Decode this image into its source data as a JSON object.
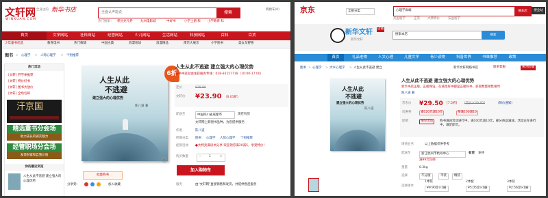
{
  "left": {
    "logo": {
      "text": "文轩网",
      "tagline": "全身边的",
      "sub": "WINXUAN.COM",
      "brand_text": "新华书店"
    },
    "search": {
      "placeholder": "全面认声能说",
      "button": "搜索"
    },
    "hot_links": [
      "热门搜索：",
      "积分兑礼券",
      "九州电影城",
      "中好书",
      "小学上册 科",
      "小学教育 科"
    ],
    "top_right": "购物车(0)",
    "nav": [
      "首页",
      "文学网站",
      "社科网站",
      "经管网站",
      "少儿网站",
      "生活网站",
      "科技网站",
      "百科",
      "百货"
    ],
    "subnav": [
      "少年童书优选",
      "教育电书",
      "热门教辅",
      "中国古典",
      "浪漫地球",
      "浪漫精品",
      "南京大展示",
      "小学图书",
      "美女与野兽"
    ],
    "breadcrumb": [
      "图书",
      "心理学",
      "人际心理学",
      "个别推荐"
    ],
    "sidebar": {
      "title": "热门活动",
      "activities": [
        "[文轩] 开学季推荐",
        "[文轩] 特价好书",
        "[文轩] 图书大放价",
        "[文轩] 全场包邮"
      ],
      "banners": [
        {
          "text": "精选重书分会场",
          "bg": "#2f8a3f"
        },
        {
          "text": "助力成长的诚实魅力",
          "bg": "#8a5a18"
        },
        {
          "text": "经管职场分会场",
          "bg": "#2f8a3f"
        },
        {
          "text": "发现财富和自我价值",
          "bg": "#8a5a18"
        }
      ],
      "recommend_title": "你的最近浏览",
      "recent_item": "人生从此不逃避 建立强大的心理优势"
    },
    "badge": "6折",
    "product": {
      "title": "人生从此不逃避 建立强大的心理优势",
      "subtitle": "购书书友就会生获服务专线：028-83157718（10:00-17:00）",
      "list_price_label": "定价",
      "list_price": "¥39.80",
      "price_label": "文轩价",
      "price": "¥23.90",
      "discount": "（6.01折）",
      "coupon_label": "促销信息",
      "delivery_label": "配送至",
      "delivery_region": "中国四川省成都市",
      "delivery_stock": "现在有货",
      "delivery_note": "文轩网上新图书品种，为您提供服务",
      "delivery_note2": "关于运费",
      "author_label": "作者",
      "author": "陈八道",
      "category_label": "所属分类",
      "category": [
        "图书",
        "心理学",
        "人际心理学",
        "个别推荐"
      ],
      "promo_label": "促销活动",
      "promo": "●大特卖满读书分享 欢迎领券满20减5，享受特价！",
      "qty_label": "购买数量",
      "qty": "1",
      "add_cart": "加入购物车",
      "bulk_buy": "批量购书",
      "share_label": "分享到：",
      "follow": "加入收藏",
      "service_label": "服务",
      "service": "由\"文轩网\"直接销售和发货，并提供售后服务"
    },
    "cover": {
      "line1": "人生从此",
      "line2": "不逃避",
      "line3": "建立强大的心理优势",
      "author": "陈八道 著"
    }
  },
  "right": {
    "logo": "京东",
    "search_category": "全部分类",
    "search_query": "心理学高端",
    "search_button": "搜本店",
    "search_button2": "搜全站",
    "top_links": [
      "英国留学",
      "正宗",
      "大牌特价",
      "法国留学"
    ],
    "store_logo": "新华文轩",
    "store_badge": "店铺",
    "store_sub": "新华文轩",
    "store_search": "搜索本店",
    "store_search_btn": "搜索",
    "nav": [
      "首页",
      "礼品老物",
      "人文心理",
      "儿童文学",
      "青少读物",
      "科普世界",
      "书单推荐",
      "政策"
    ],
    "breadcrumb": [
      "图书",
      "心理学",
      "大众心理学",
      "人生从此不逃避 建立"
    ],
    "store_name": "新华文轩网络书店",
    "contact": "联系客服",
    "follow": "关注店铺",
    "product": {
      "title": "人生从此不逃避 建立强大的心理优势",
      "promo_line": "新华书店正版，正版保证，在满足好书都是正版好书，获取数量销售限时",
      "author": "陈八道 著",
      "price_label": "京东价",
      "price": "¥29.50",
      "discount": "[7.5折]",
      "list_price": "[定价￥39.80]",
      "price_note": "（降价通知）",
      "coupon_label": "优惠券",
      "coupon": "满120元减10元",
      "coupon2": "每满100减10",
      "promo_label": "促销",
      "promo_tag": "限时活动",
      "promo_text": "购书满减活动进行中，满100元减10元，部分商品满减，活动正在进行中，满足即可。",
      "service_label": "增值业务",
      "service": "以上数据仅供参考",
      "delivery_label": "配送至",
      "delivery": "浙江杭州市杭州中心",
      "delivery_note": "有货",
      "delivery_note2": "支持",
      "delivery_extra": "满99元包邮",
      "weight_label": "重量",
      "weight": "0.3kg",
      "format_label": "选择",
      "formats": [
        "不分版",
        "平装",
        "精装"
      ],
      "editions_label": "选择版本",
      "editions": [
        "¥9.90凉×1册",
        "¥5.05凉×1册",
        "¥2.56凉×1册"
      ],
      "edition_labels": [
        "1本装",
        "2本套",
        "3本装"
      ],
      "qty": "1",
      "add_cart": "加入购物车"
    },
    "cover": {
      "line1": "人生从此",
      "line2": "不逃避",
      "line3": "建立强大的心理优势",
      "author": "陈八道"
    }
  }
}
